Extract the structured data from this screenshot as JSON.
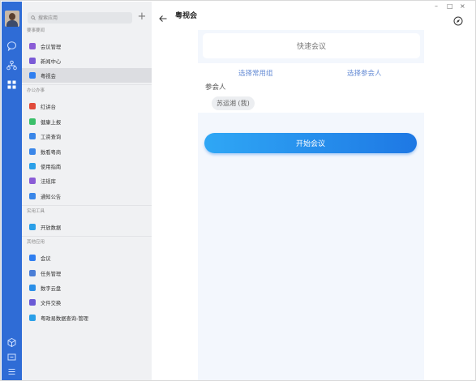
{
  "app": {
    "window_controls": {
      "minimize": "–",
      "maximize": "□",
      "close": "×"
    }
  },
  "sidebar": {
    "search_placeholder": "搜索应用",
    "add_label": "+",
    "sections": [
      {
        "title": "要事要闻",
        "items": [
          {
            "label": "会议管理",
            "icon": "meeting-manage-icon",
            "color": "#8a5cd6"
          },
          {
            "label": "新闻中心",
            "icon": "news-icon",
            "color": "#7a5ad6"
          },
          {
            "label": "粤视会",
            "icon": "video-meeting-icon",
            "color": "#2f7ef0",
            "active": true
          }
        ]
      },
      {
        "title": "办公办事",
        "items": [
          {
            "label": "红讲台",
            "icon": "red-podium-icon",
            "color": "#e04a3a"
          },
          {
            "label": "健康上报",
            "icon": "health-report-icon",
            "color": "#3bbf6a"
          },
          {
            "label": "工资查询",
            "icon": "salary-icon",
            "color": "#3a86e8"
          },
          {
            "label": "数看粤商",
            "icon": "data-view-icon",
            "color": "#3a86e8"
          },
          {
            "label": "使用指南",
            "icon": "guide-icon",
            "color": "#2a9fe8"
          },
          {
            "label": "法规库",
            "icon": "law-library-icon",
            "color": "#8a5cd6"
          },
          {
            "label": "通知公告",
            "icon": "notice-icon",
            "color": "#3a86e8"
          }
        ]
      },
      {
        "title": "实用工具",
        "items": [
          {
            "label": "开放数据",
            "icon": "open-data-icon",
            "color": "#2a9fe8"
          }
        ]
      },
      {
        "title": "其他应用",
        "items": [
          {
            "label": "会议",
            "icon": "meeting-icon",
            "color": "#2f7ef0"
          },
          {
            "label": "任务管理",
            "icon": "task-icon",
            "color": "#4a7ed6"
          },
          {
            "label": "数字云盘",
            "icon": "cloud-drive-icon",
            "color": "#2a8fe8"
          },
          {
            "label": "文件交换",
            "icon": "file-exchange-icon",
            "color": "#6a5ad6"
          },
          {
            "label": "粤政易数据查询-管理",
            "icon": "data-query-icon",
            "color": "#2a9fe8"
          }
        ]
      }
    ]
  },
  "main": {
    "title": "粤视会",
    "quick_meeting": "快速会议",
    "select_group": "选择常用组",
    "select_participants": "选择参会人",
    "participants_label": "参会人",
    "participant_chip": "苏运湘 (我)",
    "start_button": "开始会议"
  }
}
